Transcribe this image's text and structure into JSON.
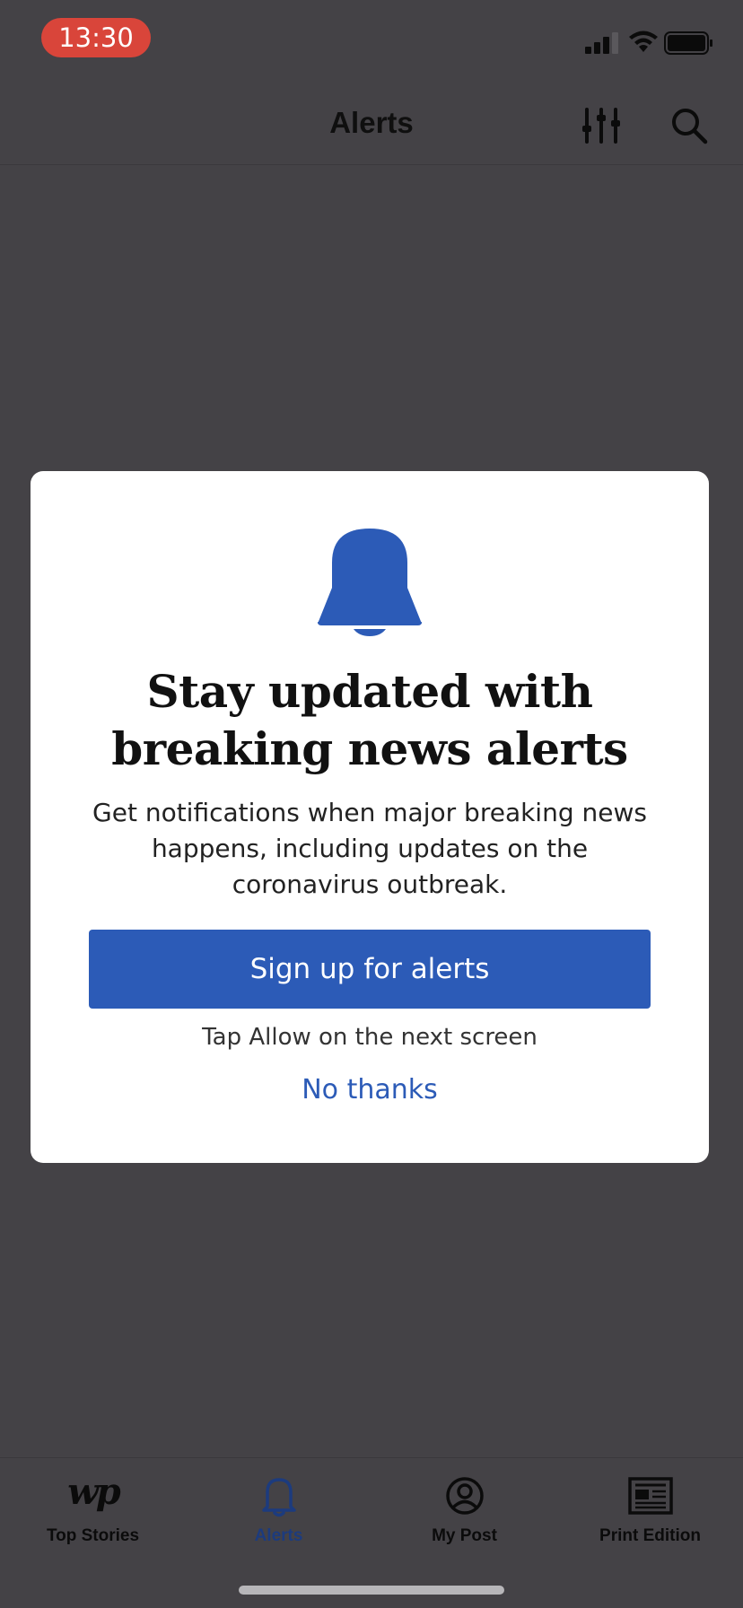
{
  "status_bar": {
    "time": "13:30",
    "time_pill_color": "#d9453a"
  },
  "nav": {
    "title": "Alerts",
    "icons": [
      "filter-sliders-icon",
      "search-icon"
    ]
  },
  "modal": {
    "icon": "bell-icon",
    "title_line1": "Stay updated with",
    "title_line2": "breaking news alerts",
    "body_line1": "Get notifications when major breaking news",
    "body_line2": "happens, including updates on the",
    "body_line3": "coronavirus outbreak.",
    "primary_button": "Sign up for alerts",
    "hint": "Tap Allow on the next screen",
    "secondary_link": "No thanks"
  },
  "tab_bar": {
    "tabs": [
      {
        "label": "Top Stories",
        "icon": "wp-logo-icon",
        "logo_text": "wp",
        "active": false
      },
      {
        "label": "Alerts",
        "icon": "bell-icon",
        "active": true
      },
      {
        "label": "My Post",
        "icon": "account-icon",
        "active": false
      },
      {
        "label": "Print Edition",
        "icon": "newspaper-icon",
        "active": false
      }
    ]
  },
  "colors": {
    "accent": "#2c5bb7",
    "overlay_background": "#444246",
    "modal_background": "#ffffff",
    "active_tab": "#1c3b7e"
  }
}
